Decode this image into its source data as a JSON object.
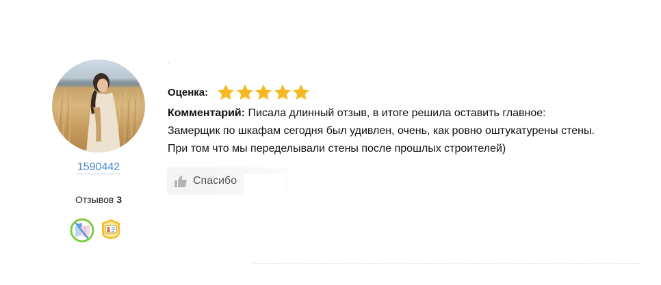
{
  "user": {
    "username": "1590442",
    "reviews_label": "Отзывов",
    "reviews_count": "3",
    "badges": [
      "map-flag-badge",
      "id-card-badge"
    ]
  },
  "review": {
    "dot": ".",
    "rating_label": "Оценка:",
    "rating": 5,
    "rating_max": 5,
    "comment_label": "Комментарий:",
    "comment_lines": [
      "Писала длинный отзыв, в итоге решила оставить главное:",
      "Замерщик по шкафам сегодня был удивлен, очень, как ровно оштукатурены стены.",
      "При том что мы переделывали стены после прошлых строителей)"
    ],
    "thanks_label": "Спасибо"
  },
  "colors": {
    "star": "#f6b921",
    "link": "#4a8ad0",
    "badge_green": "#7ccd3a",
    "badge_yellow": "#f3c12b"
  }
}
